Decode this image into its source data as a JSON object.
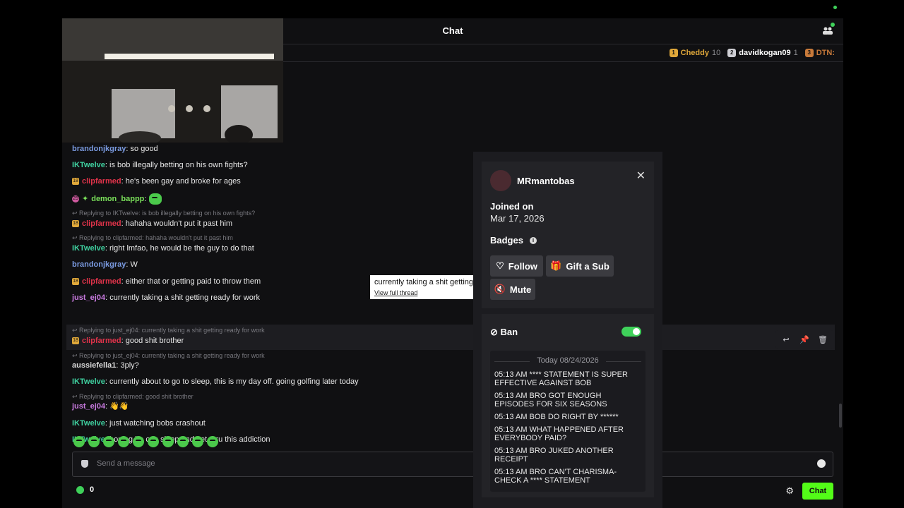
{
  "header": {
    "title": "Chat"
  },
  "leaderboard": [
    {
      "rank": "1",
      "name": "Cheddy",
      "count": "10",
      "color": "#e0a83a"
    },
    {
      "rank": "2",
      "name": "davidkogan09",
      "count": "1",
      "color": "#cfcfd4"
    },
    {
      "rank": "3",
      "name": "DTN:",
      "count": "",
      "color": "#c87a3a"
    }
  ],
  "messages": [
    {
      "user": "brandonjkgray",
      "color": "#7a9ae0",
      "text": "so good"
    },
    {
      "user": "IKTwelve",
      "color": "#3fd1a0",
      "text": "is bob illegally betting on his own fights?"
    },
    {
      "badge": "18",
      "user": "clipfarmed",
      "color": "#e0334a",
      "text": "he's been gay and broke for ages"
    },
    {
      "badge": "25",
      "user": "demon_bappp",
      "color": "#7ae05a",
      "text": ""
    },
    {
      "reply": "Replying to IKTwelve: is bob illegally betting on his own fights?",
      "badge": "18",
      "user": "clipfarmed",
      "color": "#e0334a",
      "text": "hahaha wouldn't put it past him"
    },
    {
      "reply": "Replying to clipfarmed: hahaha wouldn't put it past him",
      "user": "IKTwelve",
      "color": "#3fd1a0",
      "text": "right lmfao, he would be the guy to do that"
    },
    {
      "user": "brandonjkgray",
      "color": "#7a9ae0",
      "text": "W"
    },
    {
      "badge": "18",
      "user": "clipfarmed",
      "color": "#e0334a",
      "text": "either that or getting paid to throw them"
    },
    {
      "user": "just_ej04",
      "color": "#c97ae0",
      "text": "currently taking a shit getting ready for work"
    },
    {
      "reply": "Replying to just_ej04: currently taking a shit getting ready for work",
      "badge": "18",
      "user": "clipfarmed",
      "color": "#e0334a",
      "text": "good shit brother"
    },
    {
      "reply": "Replying to just_ej04: currently taking a shit getting ready for work",
      "user": "aussiefella1",
      "color": "#d8d8d8",
      "text": "3ply?"
    },
    {
      "user": "IKTwelve",
      "color": "#3fd1a0",
      "text": "currently about to go to sleep, this is my day off. going golfing later today"
    },
    {
      "reply": "Replying to clipfarmed: good shit brother",
      "user": "just_ej04",
      "color": "#c97ae0",
      "text": ""
    },
    {
      "user": "IKTwelve",
      "color": "#3fd1a0",
      "text": "just watching bobs crashout"
    },
    {
      "user": "IKTwelve",
      "color": "#3fd1a0",
      "text": "hoping he can sleep and get thru this addiction"
    }
  ],
  "tooltip": {
    "text": "currently taking a shit getting",
    "link": "View full thread"
  },
  "input": {
    "placeholder": "Send a message"
  },
  "footer": {
    "points": "0",
    "chat_button": "Chat"
  },
  "profile": {
    "name": "MRmantobas",
    "joined_label": "Joined on",
    "joined_date": "Mar 17, 2026",
    "badges_label": "Badges",
    "follow": "Follow",
    "gift": "Gift a Sub",
    "mute": "Mute",
    "ban_label": "Ban",
    "log_date": "Today 08/24/2026",
    "log": [
      "05:13 AM **** STATEMENT IS SUPER EFFECTIVE AGAINST BOB",
      "05:13 AM BRO GOT ENOUGH EPISODES FOR SIX SEASONS",
      "05:13 AM BOB DO RIGHT BY ******",
      "05:13 AM WHAT HAPPENED AFTER EVERYBODY PAID?",
      "05:13 AM BRO JUKED ANOTHER RECEIPT",
      "05:13 AM BRO CAN'T CHARISMA-CHECK A **** STATEMENT"
    ]
  }
}
